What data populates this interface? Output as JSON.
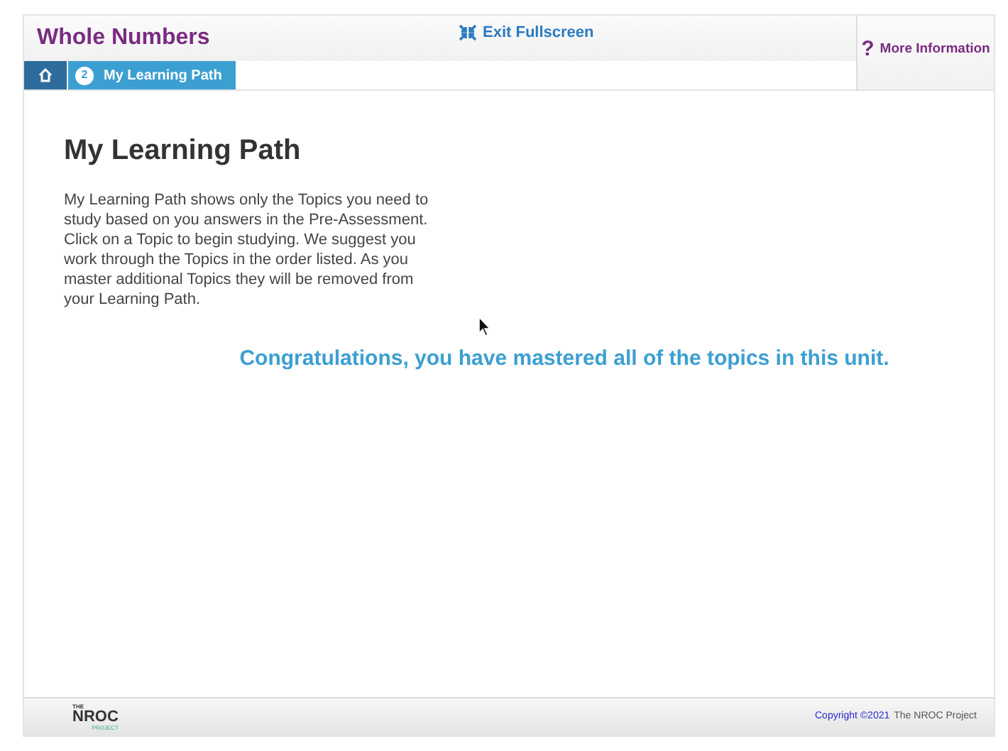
{
  "header": {
    "title": "Whole Numbers",
    "fullscreen_link": "Exit Fullscreen",
    "more_info": "More Information",
    "more_info_icon": "?"
  },
  "breadcrumb": [
    {
      "kind": "home"
    },
    {
      "kind": "step",
      "number": "2",
      "label": "My Learning Path",
      "selected": true
    }
  ],
  "content": {
    "heading": "My Learning Path",
    "description": "My Learning Path shows only the Topics you need to study based on you answers in the Pre-Assessment. Click on a Topic to begin studying. We suggest you work through the Topics in the order listed. As you master additional Topics they will be removed from your Learning Path.",
    "message": "Congratulations, you have mastered all of the topics in this unit."
  },
  "footer": {
    "logo_top": "THE",
    "logo_main": "NROC",
    "logo_bottom": "PROJECT",
    "copyright_link": "Copyright ©2021",
    "copyright_owner": "The NROC Project"
  }
}
